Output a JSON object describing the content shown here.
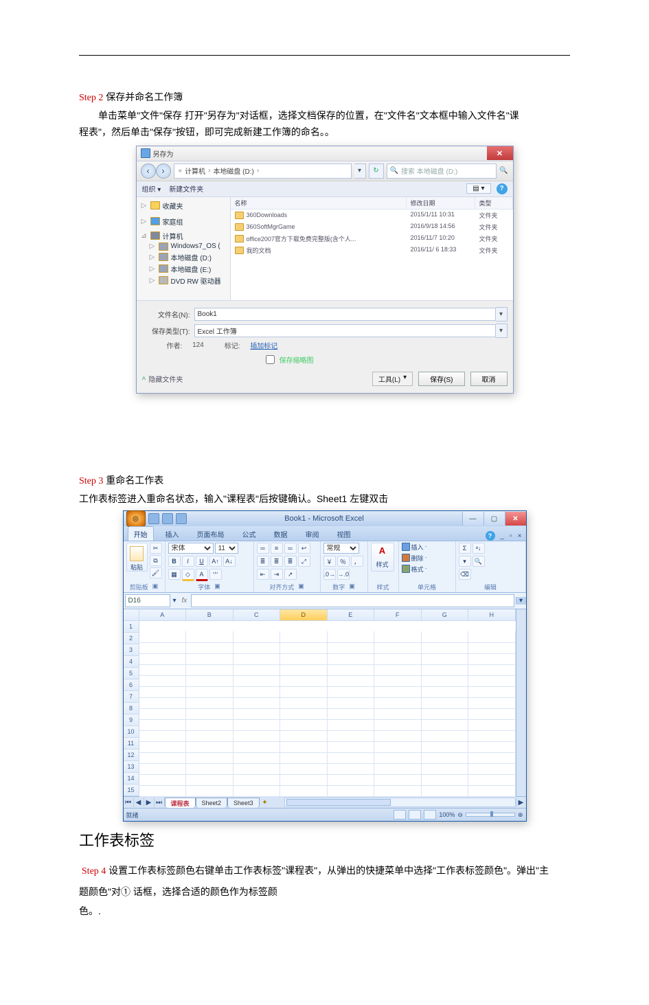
{
  "step2": {
    "label": "Step 2",
    "title": "保存并命名工作簿",
    "para_a": "单击菜单\"文件\"保存 打开\"另存为\"对话框，选择文档保存的位置，在\"文件名\"文本框中输入文件名\"课",
    "para_b": "程表\"，然后单击\"保存\"按钮，即可完成新建工作簿的命名。。"
  },
  "saveas": {
    "title": "另存为",
    "breadcrumb": {
      "seg1": "计算机",
      "seg2": "本地磁盘 (D:)"
    },
    "search_placeholder": "搜索 本地磁盘 (D:)",
    "toolbar": {
      "organize": "组织 ▾",
      "newfolder": "新建文件夹",
      "view": "▤ ▾"
    },
    "sidebar": [
      {
        "text": "收藏夹",
        "icon": "star"
      },
      {
        "text": "家庭组",
        "icon": "desk"
      },
      {
        "text": "计算机",
        "icon": "pc"
      },
      {
        "text": "Windows7_OS (",
        "icon": "hd"
      },
      {
        "text": "本地磁盘 (D:)",
        "icon": "hd"
      },
      {
        "text": "本地磁盘 (E:)",
        "icon": "hd"
      },
      {
        "text": "DVD RW 驱动器",
        "icon": "dvd"
      }
    ],
    "columns": {
      "name": "名称",
      "date": "修改日期",
      "type": "类型"
    },
    "rows": [
      {
        "name": "360Downloads",
        "date": "2015/1/11 10:31",
        "type": "文件夹"
      },
      {
        "name": "360SoftMgrGame",
        "date": "2016/9/18 14:56",
        "type": "文件夹"
      },
      {
        "name": "office2007官方下载免费完整版(含个人...",
        "date": "2016/11/7 10:20",
        "type": "文件夹"
      },
      {
        "name": "我的文档",
        "date": "2016/11/ 6 18:33",
        "type": "文件夹"
      }
    ],
    "filename_label": "文件名(N):",
    "filename_value": "Book1",
    "filetype_label": "保存类型(T):",
    "filetype_value": "Excel 工作簿",
    "author_label": "作者:",
    "author_value": "124",
    "tags_label": "标记:",
    "tags_value": "插加标记",
    "thumbnail_chk": "保存缩略图",
    "hide_folders": "隐藏文件夹",
    "tools": "工具(L)",
    "save": "保存(S)",
    "cancel": "取消"
  },
  "step3": {
    "label": "Step 3",
    "title": "重命名工作表",
    "para": " 工作表标签进入重命名状态，输入\"课程表\"后按键确认。Sheet1 左键双击"
  },
  "excel": {
    "title": "Book1 - Microsoft Excel",
    "tabs": [
      "开始",
      "插入",
      "页面布局",
      "公式",
      "数据",
      "审阅",
      "视图"
    ],
    "groups": {
      "clipboard": "剪贴板",
      "font": "字体",
      "align": "对齐方式",
      "number": "数字",
      "styles": "样式",
      "cells": "单元格",
      "editing": "编辑"
    },
    "font_name": "宋体",
    "font_size": "11",
    "number_label": "常规",
    "percent_label": "％",
    "comma_label": "，",
    "styles_btn": "A\n样式",
    "cells_insert": "插入",
    "cells_delete": "删除",
    "cells_format": "格式",
    "namebox": "D16",
    "col_headers": [
      "A",
      "B",
      "C",
      "D",
      "E",
      "F",
      "G",
      "H"
    ],
    "row_count": 15,
    "active_col_index": 3,
    "active_row": 16,
    "sheets": {
      "active": "课程表",
      "s2": "Sheet2",
      "s3": "Sheet3"
    },
    "status_ready": "就绪",
    "zoom": "100%"
  },
  "sheet_tab_label": "工作表标签",
  "step4": {
    "label": "Step 4",
    "line1_a": "设置工作表标签颜色右键单击工作表标签\"课程表\"，从弹出的快捷菜单中选择\"工作表标签颜色\"。弹出\"主",
    "line2": "题颜色\"对① 话框，选择合适的颜色作为标签颜",
    "line3": "色。."
  }
}
